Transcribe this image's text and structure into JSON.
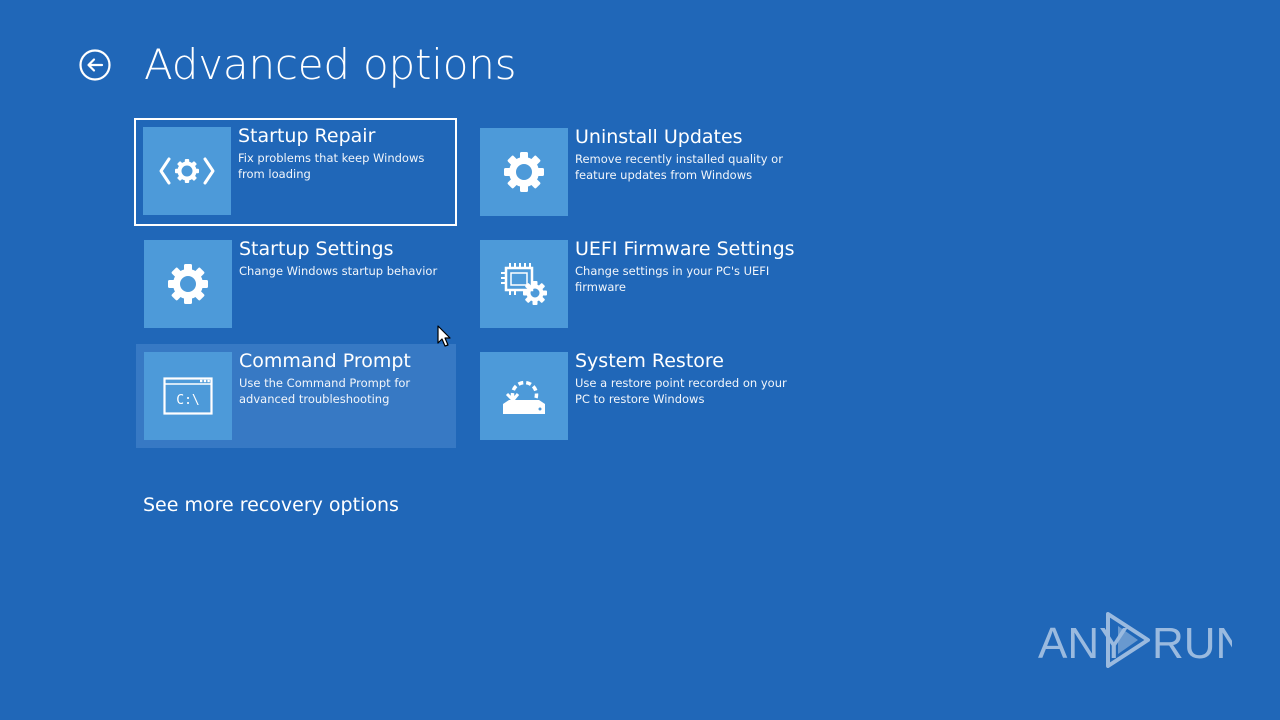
{
  "header": {
    "title": "Advanced options",
    "back_icon": "back-arrow-icon"
  },
  "options": [
    {
      "title": "Startup Repair",
      "description": "Fix problems that keep Windows from loading",
      "icon": "startup-repair-icon",
      "state": "selected"
    },
    {
      "title": "Uninstall Updates",
      "description": "Remove recently installed quality or feature updates from Windows",
      "icon": "gear-icon"
    },
    {
      "title": "Startup Settings",
      "description": "Change Windows startup behavior",
      "icon": "gear-icon"
    },
    {
      "title": "UEFI Firmware Settings",
      "description": "Change settings in your PC's UEFI firmware",
      "icon": "firmware-chip-gear-icon"
    },
    {
      "title": "Command Prompt",
      "description": "Use the Command Prompt for advanced troubleshooting",
      "icon": "command-prompt-icon",
      "icon_text": "C:\\",
      "state": "hover"
    },
    {
      "title": "System Restore",
      "description": "Use a restore point recorded on your PC to restore Windows",
      "icon": "system-restore-icon"
    }
  ],
  "footer": {
    "more_options_label": "See more recovery options"
  },
  "watermark": {
    "text_left": "ANY",
    "text_right": "RUN"
  },
  "colors": {
    "background": "#2067b8",
    "icon_tile": "#4d9ad9",
    "hover_tile": "#3779c4",
    "text": "#ffffff"
  }
}
